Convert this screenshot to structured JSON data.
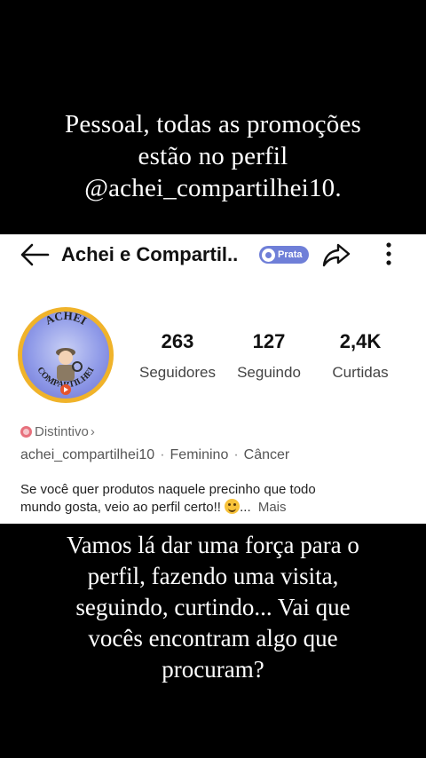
{
  "top_caption": {
    "line1": "Pessoal, todas as promoções",
    "line2": "estão no perfil",
    "line3": "@achei_compartilhei10."
  },
  "profile": {
    "title": "Achei e Compartil..",
    "badge": "Prata",
    "avatar_text": "ACHEI COMPARTILHEI",
    "stats": [
      {
        "value": "263",
        "label": "Seguidores"
      },
      {
        "value": "127",
        "label": "Seguindo"
      },
      {
        "value": "2,4K",
        "label": "Curtidas"
      }
    ],
    "distintivo": "Distintivo",
    "chevron": "›",
    "meta": {
      "username": "achei_compartilhei10",
      "separator": "·",
      "gender": "Feminino",
      "sign": "Câncer"
    },
    "bio": {
      "line1": "Se você quer produtos naquele precinho que todo",
      "line2": "mundo gosta, veio ao perfil certo!!",
      "ellipsis": "...",
      "more": "Mais"
    }
  },
  "bottom_caption": {
    "line1": "Vamos lá dar uma força para o",
    "line2": "perfil, fazendo uma visita,",
    "line3": "seguindo, curtindo... Vai que",
    "line4": "vocês encontram algo que",
    "line5": "procuram?"
  },
  "icons": {
    "back": "back-arrow-icon",
    "share": "share-icon",
    "more": "more-vertical-icon"
  },
  "colors": {
    "badge": "#6f7fd8",
    "avatar_ring": "#f0b32a",
    "distintivo_icon": "#e7717d"
  }
}
